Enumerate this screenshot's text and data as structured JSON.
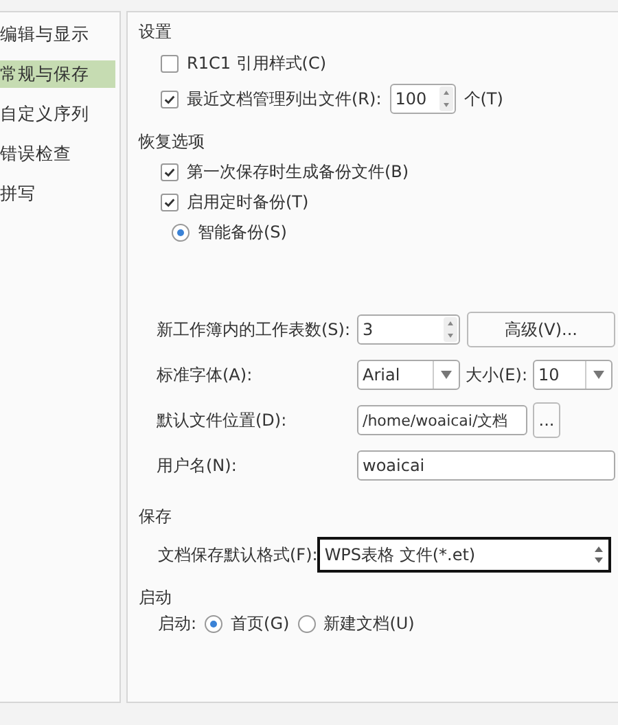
{
  "sidebar": {
    "items": [
      {
        "label": "编辑与显示",
        "selected": false
      },
      {
        "label": "常规与保存",
        "selected": true
      },
      {
        "label": "自定义序列",
        "selected": false
      },
      {
        "label": "错误检查",
        "selected": false
      },
      {
        "label": "拼写",
        "selected": false
      }
    ]
  },
  "settings": {
    "heading": "设置",
    "options": [
      {
        "label": "R1C1 引用样式(C)",
        "checked": false
      },
      {
        "label": "最近文档管理列出文件(R):",
        "checked": true,
        "value": "100",
        "unit": "个(T)"
      }
    ]
  },
  "recovery": {
    "heading": "恢复选项",
    "options": [
      {
        "label": "第一次保存时生成备份文件(B)",
        "checked": true
      },
      {
        "label": "启用定时备份(T)",
        "checked": true
      }
    ],
    "smart_backup": {
      "label": "智能备份(S)",
      "selected": true
    }
  },
  "general": {
    "sheets_label": "新工作簿内的工作表数(S):",
    "sheets_value": "3",
    "advanced_button": "高级(V)...",
    "font_label": "标准字体(A):",
    "font_value": "Arial",
    "size_label": "大小(E):",
    "size_value": "10",
    "location_label": "默认文件位置(D):",
    "location_value": "/home/woaicai/文档",
    "browse_button": "...",
    "username_label": "用户名(N):",
    "username_value": "woaicai"
  },
  "save": {
    "heading": "保存",
    "format_label": "文档保存默认格式(F):",
    "format_value": "WPS表格 文件(*.et)",
    "focused": true
  },
  "startup": {
    "heading": "启动",
    "label": "启动:",
    "options": [
      {
        "label": "首页(G)",
        "selected": true
      },
      {
        "label": "新建文档(U)",
        "selected": false
      }
    ]
  }
}
